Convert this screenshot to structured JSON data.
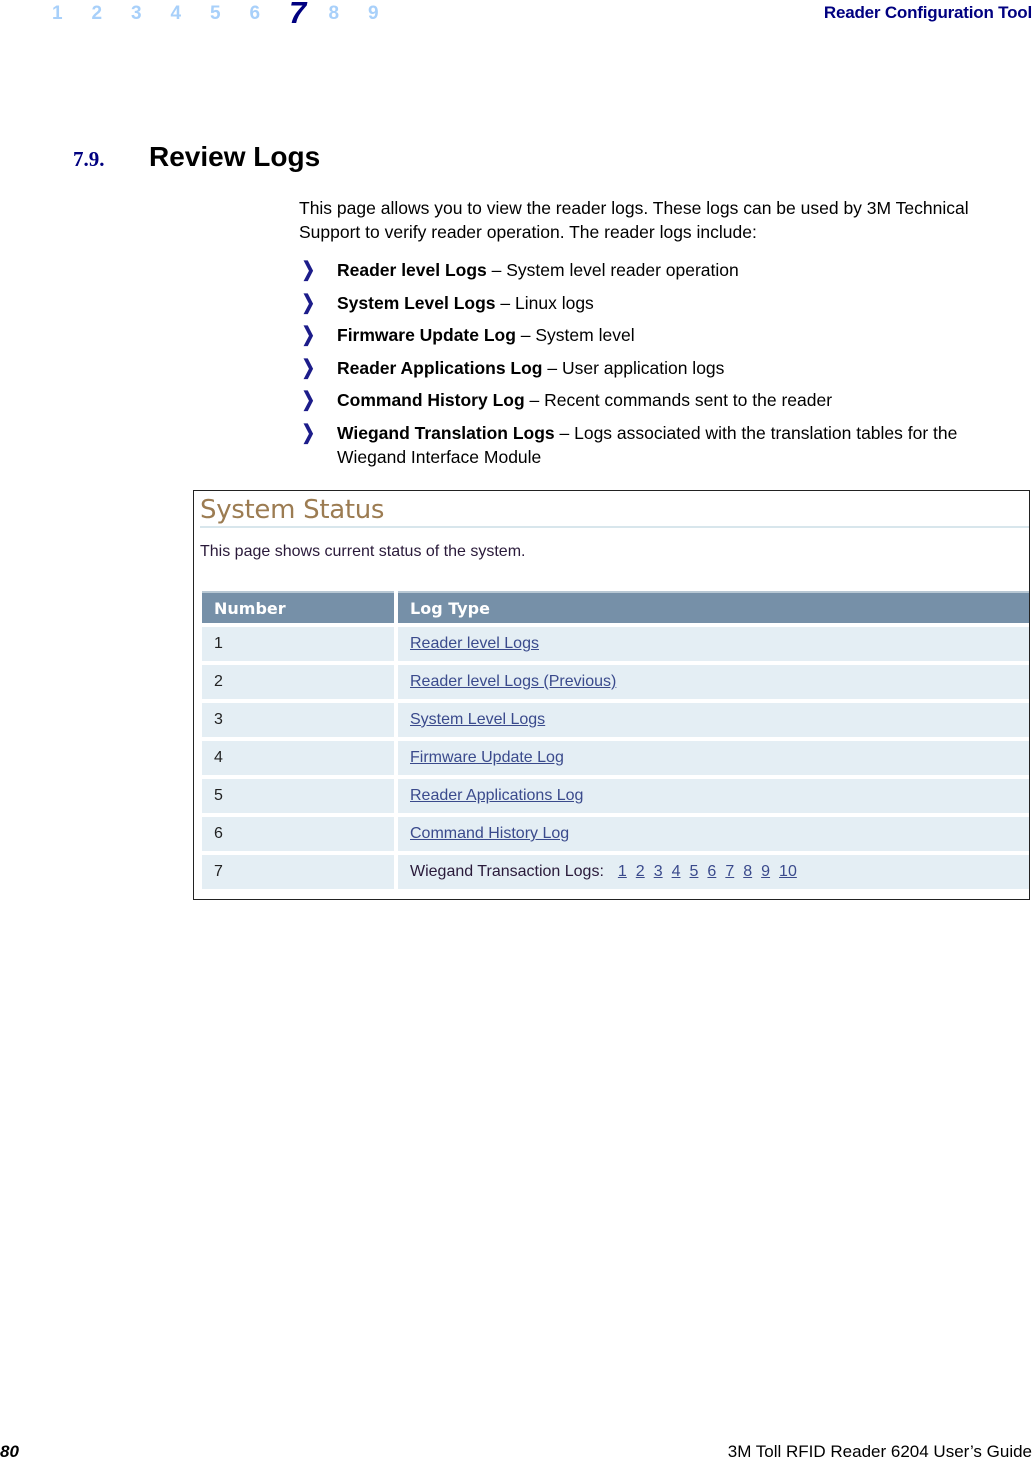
{
  "header": {
    "chapters": [
      "1",
      "2",
      "3",
      "4",
      "5",
      "6",
      "7",
      "8",
      "9"
    ],
    "active_chapter": "7",
    "title": "Reader Configuration Tool"
  },
  "section": {
    "number": "7.9.",
    "title": "Review Logs"
  },
  "intro": "This page allows you to view the reader logs. These logs can be used by 3M Technical Support to verify reader operation. The reader logs include:",
  "bullets": [
    {
      "term": "Reader level Logs",
      "desc": " – System level reader operation"
    },
    {
      "term": "System Level Logs",
      "desc": " – Linux logs"
    },
    {
      "term": "Firmware Update Log",
      "desc": " – System level"
    },
    {
      "term": "Reader Applications Log",
      "desc": " – User application logs"
    },
    {
      "term": "Command History Log",
      "desc": " – Recent commands sent to the reader"
    },
    {
      "term": "Wiegand Translation Logs",
      "desc": " – Logs associated with the translation tables for the Wiegand Interface Module"
    }
  ],
  "bullet_icon": "chevron-right",
  "screenshot": {
    "title": "System Status",
    "description": "This page shows current status of the system.",
    "columns": [
      "Number",
      "Log Type"
    ],
    "rows": [
      {
        "number": "1",
        "log_type": "Reader level Logs"
      },
      {
        "number": "2",
        "log_type": "Reader level Logs (Previous)"
      },
      {
        "number": "3",
        "log_type": "System Level Logs"
      },
      {
        "number": "4",
        "log_type": "Firmware Update Log"
      },
      {
        "number": "5",
        "log_type": "Reader Applications Log"
      },
      {
        "number": "6",
        "log_type": "Command History Log"
      }
    ],
    "wiegand_row": {
      "number": "7",
      "label": "Wiegand Transaction Logs:",
      "links": [
        "1",
        "2",
        "3",
        "4",
        "5",
        "6",
        "7",
        "8",
        "9",
        "10"
      ]
    }
  },
  "footer": {
    "page_number": "80",
    "guide_title": "3M Toll RFID Reader 6204 User’s Guide"
  },
  "colors": {
    "chapter_inactive": "#a8d0fa",
    "chapter_active": "#000080",
    "table_header_bg": "#7690a8",
    "table_row_bg": "#e4eef4",
    "link": "#3a4a8c",
    "shot_title": "#9c7c52"
  }
}
